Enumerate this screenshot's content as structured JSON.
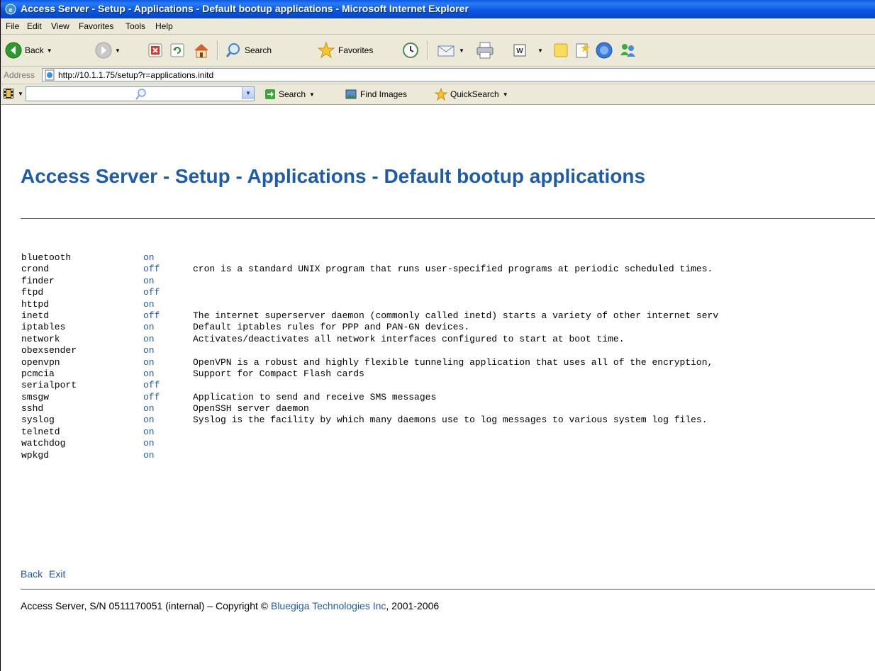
{
  "window": {
    "title": "Access Server - Setup - Applications - Default bootup applications - Microsoft Internet Explorer"
  },
  "menu": [
    "File",
    "Edit",
    "View",
    "Favorites",
    "Tools",
    "Help"
  ],
  "toolbar": {
    "back_label": "Back",
    "search_label": "Search",
    "favorites_label": "Favorites"
  },
  "address": {
    "label": "Address",
    "url": "http://10.1.1.75/setup?r=applications.initd"
  },
  "search_toolbar": {
    "search_label": "Search",
    "find_images_label": "Find Images",
    "quicksearch_label": "QuickSearch"
  },
  "page": {
    "title": "Access Server - Setup - Applications - Default bootup applications",
    "applications": [
      {
        "name": "bluetooth",
        "status": "on",
        "description": ""
      },
      {
        "name": "crond",
        "status": "off",
        "description": "cron is a standard UNIX program that runs user-specified programs at periodic scheduled times."
      },
      {
        "name": "finder",
        "status": "on",
        "description": ""
      },
      {
        "name": "ftpd",
        "status": "off",
        "description": ""
      },
      {
        "name": "httpd",
        "status": "on",
        "description": ""
      },
      {
        "name": "inetd",
        "status": "off",
        "description": "The internet superserver daemon (commonly called inetd) starts a variety of other internet serv"
      },
      {
        "name": "iptables",
        "status": "on",
        "description": "Default iptables rules for PPP and PAN-GN devices."
      },
      {
        "name": "network",
        "status": "on",
        "description": "Activates/deactivates all network interfaces configured to start at boot time."
      },
      {
        "name": "obexsender",
        "status": "on",
        "description": ""
      },
      {
        "name": "openvpn",
        "status": "on",
        "description": "OpenVPN is a robust and highly flexible tunneling application that uses all of the encryption,"
      },
      {
        "name": "pcmcia",
        "status": "on",
        "description": "Support for Compact Flash cards"
      },
      {
        "name": "serialport",
        "status": "off",
        "description": ""
      },
      {
        "name": "smsgw",
        "status": "off",
        "description": "Application to send and receive SMS messages"
      },
      {
        "name": "sshd",
        "status": "on",
        "description": "OpenSSH server daemon"
      },
      {
        "name": "syslog",
        "status": "on",
        "description": "Syslog is the facility by which many daemons use to log messages to various system log files."
      },
      {
        "name": "telnetd",
        "status": "on",
        "description": ""
      },
      {
        "name": "watchdog",
        "status": "on",
        "description": ""
      },
      {
        "name": "wpkgd",
        "status": "on",
        "description": ""
      }
    ],
    "back_link": "Back",
    "exit_link": "Exit",
    "footer": {
      "prefix": "Access Server, S/N 0511170051 (internal) – Copyright © ",
      "company": "Bluegiga Technologies Inc",
      "suffix": ", 2001-2006"
    }
  }
}
